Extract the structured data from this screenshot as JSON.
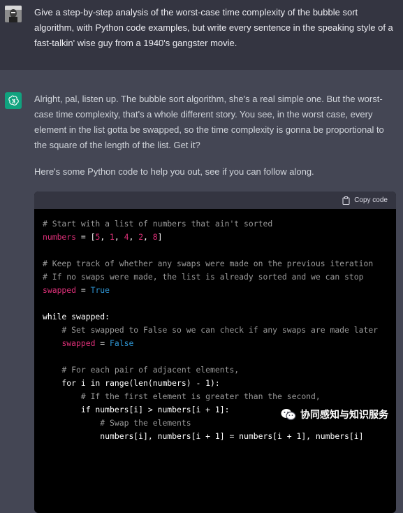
{
  "user_message": {
    "text": "Give a step-by-step analysis of the worst-case time complexity of the bubble sort algorithm, with Python code examples, but write every sentence in the speaking style of a fast-talkin' wise guy from a 1940's gangster movie."
  },
  "assistant_message": {
    "paragraph_1": "Alright, pal, listen up. The bubble sort algorithm, she's a real simple one. But the worst-case time complexity, that's a whole different story. You see, in the worst case, every element in the list gotta be swapped, so the time complexity is gonna be proportional to the square of the length of the list. Get it?",
    "paragraph_2": "Here's some Python code to help you out, see if you can follow along.",
    "code_block": {
      "copy_label": "Copy code",
      "lines": {
        "l1": "# Start with a list of numbers that ain't sorted",
        "l2a": "numbers",
        "l2b": " = [",
        "l2c": "5",
        "l2d": ", ",
        "l2e": "1",
        "l2f": ", ",
        "l2g": "4",
        "l2h": ", ",
        "l2i": "2",
        "l2j": ", ",
        "l2k": "8",
        "l2l": "]",
        "l4": "# Keep track of whether any swaps were made on the previous iteration",
        "l5": "# If no swaps were made, the list is already sorted and we can stop",
        "l6a": "swapped",
        "l6b": " = ",
        "l6c": "True",
        "l8": "while swapped:",
        "l9": "    # Set swapped to False so we can check if any swaps are made later",
        "l10i": "    ",
        "l10a": "swapped",
        "l10b": " = ",
        "l10c": "False",
        "l12": "    # For each pair of adjacent elements,",
        "l13": "    for i in range(len(numbers) - 1):",
        "l14": "        # If the first element is greater than the second,",
        "l15": "        if numbers[i] > numbers[i + 1]:",
        "l16": "            # Swap the elements",
        "l17": "            numbers[i], numbers[i + 1] = numbers[i + 1], numbers[i]"
      }
    }
  },
  "watermark": {
    "text": "协同感知与知识服务"
  },
  "colors": {
    "user_bg": "#343541",
    "assistant_bg": "#444654",
    "bot_avatar": "#10a37f",
    "code_bg": "#000000",
    "code_header_bg": "#343541"
  }
}
